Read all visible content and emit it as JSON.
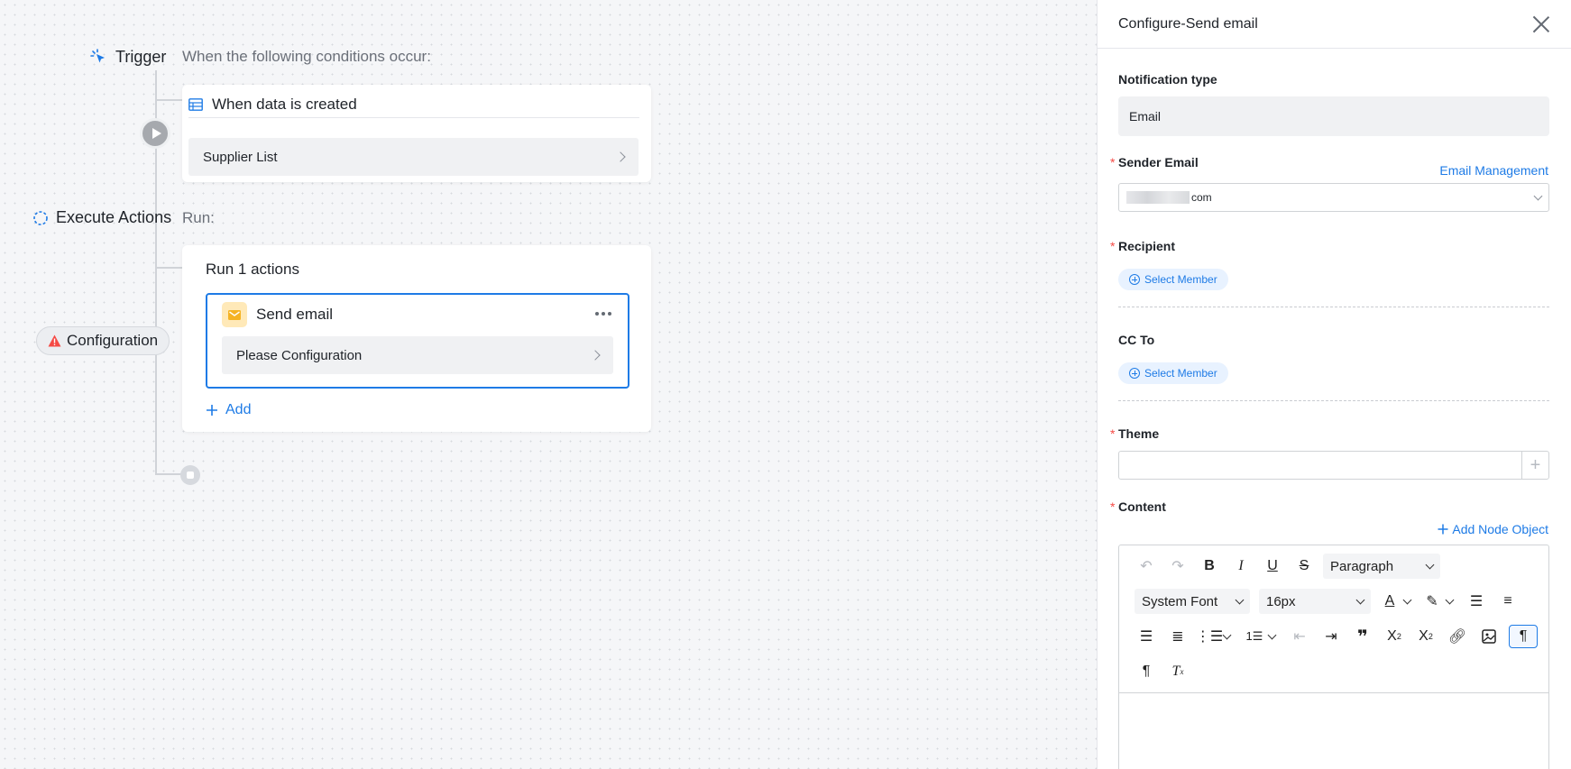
{
  "flow": {
    "trigger": {
      "label": "Trigger",
      "subtitle": "When the following conditions occur:"
    },
    "trigger_card": {
      "title": "When data is created",
      "row": "Supplier List"
    },
    "execute": {
      "label": "Execute Actions",
      "subtitle": "Run:"
    },
    "run_card": {
      "title": "Run 1 actions",
      "action_title": "Send email",
      "action_row": "Please Configuration",
      "add_label": "Add"
    },
    "config_badge": "Configuration"
  },
  "panel": {
    "title": "Configure-Send email",
    "notification_type": {
      "label": "Notification type",
      "value": "Email"
    },
    "sender": {
      "label": "Sender Email",
      "link": "Email Management",
      "value_suffix": "com"
    },
    "recipient": {
      "label": "Recipient",
      "button": "Select Member"
    },
    "cc": {
      "label": "CC To",
      "button": "Select Member"
    },
    "theme": {
      "label": "Theme",
      "value": ""
    },
    "content": {
      "label": "Content",
      "link": "Add Node Object"
    },
    "editor": {
      "block_format": "Paragraph",
      "font_family": "System Font",
      "font_size": "16px"
    }
  },
  "colors": {
    "accent": "#1e7be6",
    "required": "#f54a45",
    "warning": "#f54a45",
    "mail_icon_bg": "#ffe9b8"
  }
}
